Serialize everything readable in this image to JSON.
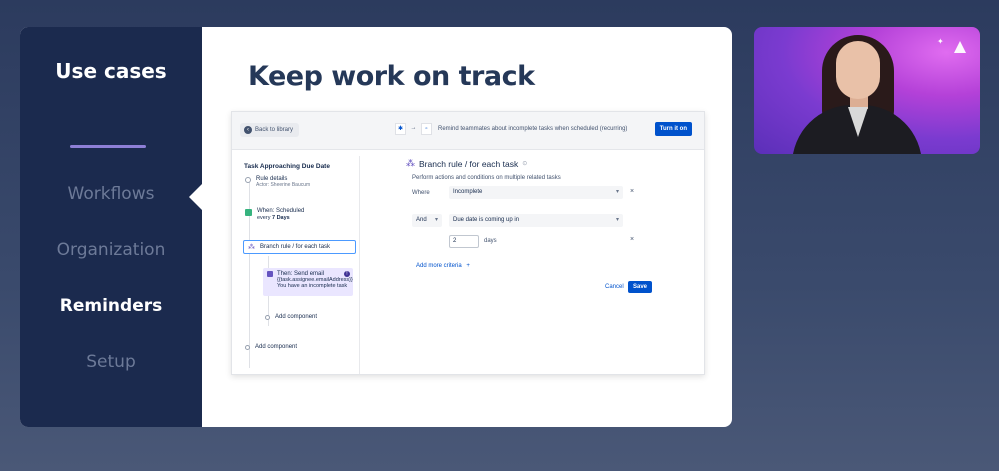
{
  "slide": {
    "section_title": "Use cases",
    "nav_items": [
      "Workflows",
      "Organization",
      "Reminders",
      "Setup"
    ],
    "active_index": 2,
    "title": "Keep work on track"
  },
  "screenshot": {
    "back_label": "Back to library",
    "description": "Remind teammates about incomplete tasks when scheduled (recurring)",
    "turn_on_label": "Turn it on",
    "rule_title": "Task Approaching Due Date",
    "rule_details": "Rule details",
    "rule_actor": "Actor: Sheerine Baucum",
    "when_label": "When: Scheduled",
    "when_sub_prefix": "every ",
    "when_sub_value": "7 Days",
    "branch_label": "Branch rule / for each task",
    "send_title": "Then: Send email",
    "send_line1": "{{task.assignee.emailAddress}}",
    "send_line2": "You have an incomplete task",
    "add_component_inner": "Add component",
    "add_component_outer": "Add component",
    "panel_title": "Branch rule / for each task",
    "panel_desc": "Perform actions and conditions on multiple related tasks",
    "where_label": "Where",
    "where_value": "Incomplete",
    "and_label": "And",
    "cond_value": "Due date is coming up in",
    "num_value": "2",
    "num_unit": "days",
    "add_criteria": "Add more criteria",
    "cancel_label": "Cancel",
    "save_label": "Save"
  },
  "colors": {
    "nav_bg": "#1b2a4e",
    "accent": "#0052cc",
    "purple": "#8e7fd6"
  }
}
